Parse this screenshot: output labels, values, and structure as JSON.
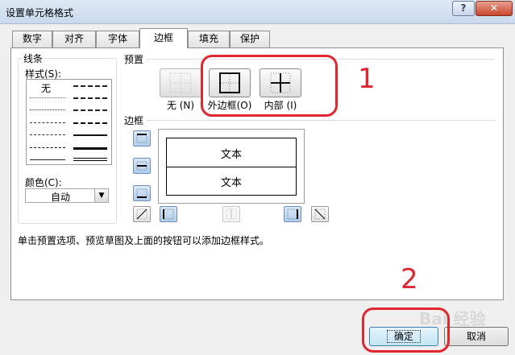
{
  "window": {
    "title": "设置单元格格式",
    "help": "?",
    "close": "✕"
  },
  "tabs": [
    {
      "label": "数字"
    },
    {
      "label": "对齐"
    },
    {
      "label": "字体"
    },
    {
      "label": "边框"
    },
    {
      "label": "填充"
    },
    {
      "label": "保护"
    }
  ],
  "line_section": {
    "title": "线条",
    "style_label": "样式(S):",
    "none_label": "无",
    "color_label": "颜色(C):",
    "color_value": "自动"
  },
  "presets": {
    "title": "预置",
    "none_label": "无 (N)",
    "outline_label": "外边框(O)",
    "inside_label": "内部 (I)"
  },
  "border": {
    "title": "边框",
    "preview_text_top": "文本",
    "preview_text_bottom": "文本"
  },
  "hint": "单击预置选项、预览草图及上面的按钮可以添加边框样式。",
  "buttons": {
    "ok": "确定",
    "cancel": "取消"
  },
  "annotations": {
    "num1": "1",
    "num2": "2",
    "color": "#e0262f"
  },
  "watermark": "Bai 经验"
}
